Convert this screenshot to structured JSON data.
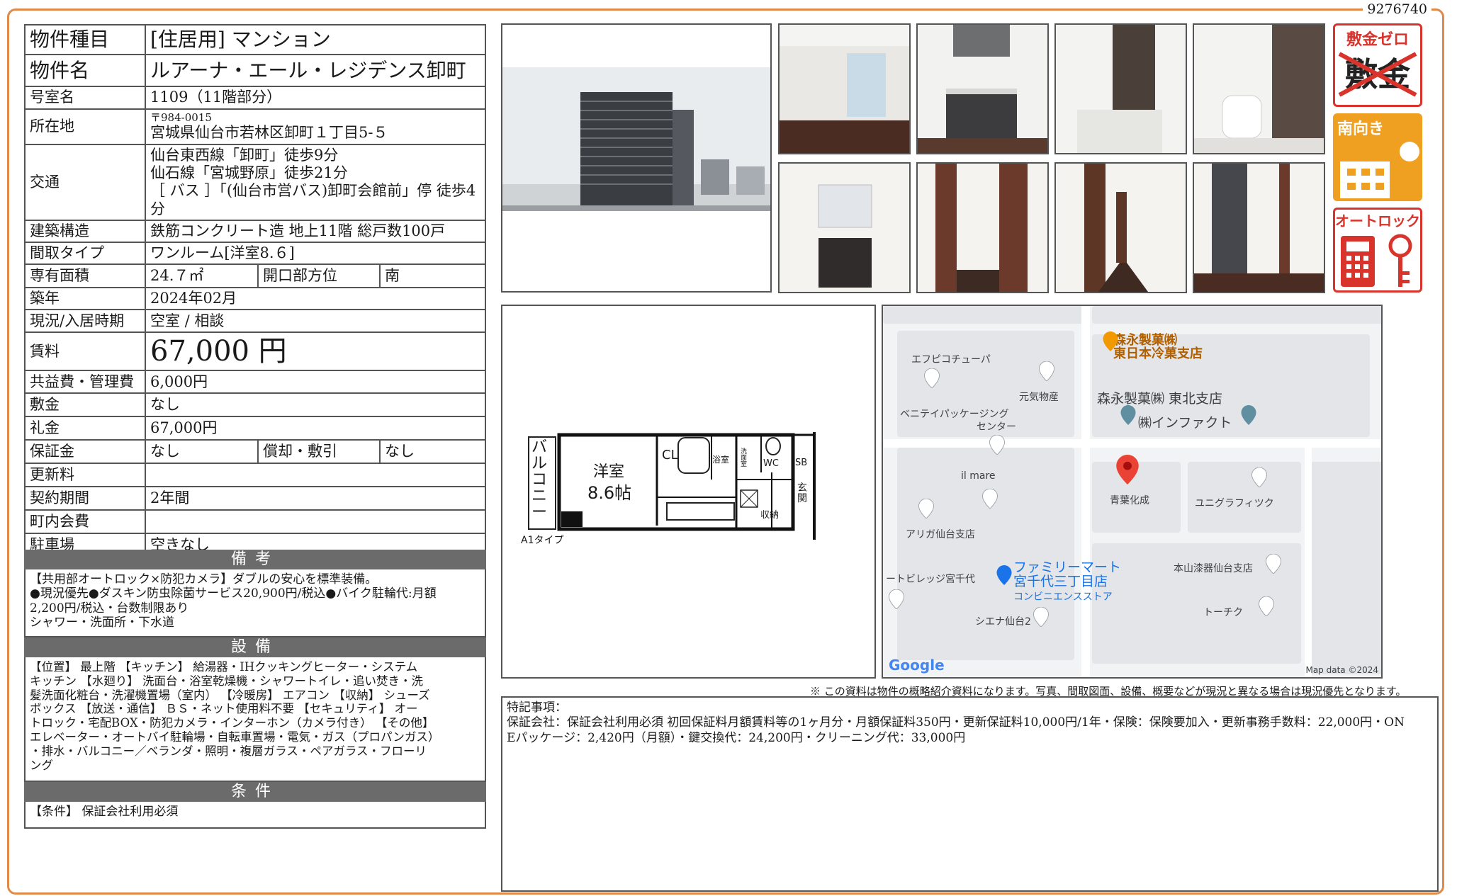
{
  "doc_id": "9276740",
  "spec": {
    "type_label": "物件種目",
    "type_value": "[住居用] マンション",
    "name_label": "物件名",
    "name_value": "ルアーナ・エール・レジデンス卸町",
    "room_label": "号室名",
    "room_value": "1109（11階部分）",
    "address_label": "所在地",
    "postal": "〒984-0015",
    "address_value": "宮城県仙台市若林区卸町１丁目5-５",
    "transit_label": "交通",
    "transit_1": "仙台東西線「卸町」徒歩9分",
    "transit_2": "仙石線「宮城野原」徒歩21分",
    "transit_3": "［ バス ］「(仙台市営バス)卸町会館前」停 徒歩4分",
    "structure_label": "建築構造",
    "structure_value": "鉄筋コンクリート造 地上11階 総戸数100戸",
    "layout_label": "間取タイプ",
    "layout_value": "ワンルーム[洋室8.６]",
    "area_label": "専有面積",
    "area_value": "24.７㎡",
    "direction_label": "開口部方位",
    "direction_value": "南",
    "built_label": "築年",
    "built_value": "2024年02月",
    "status_label": "現況/入居時期",
    "status_value": "空室 / 相談",
    "rent_label": "賃料",
    "rent_value": "67,000 円",
    "fee_label": "共益費・管理費",
    "fee_value": "6,000円",
    "deposit_label": "敷金",
    "deposit_value": "なし",
    "keymoney_label": "礼金",
    "keymoney_value": "67,000円",
    "guarantee_label": "保証金",
    "guarantee_value": "なし",
    "amort_label": "償却・敷引",
    "amort_value": "なし",
    "renewal_label": "更新料",
    "renewal_value": "",
    "contract_label": "契約期間",
    "contract_value": "2年間",
    "council_label": "町内会費",
    "council_value": "",
    "parking_label": "駐車場",
    "parking_value": "空きなし"
  },
  "remarks": {
    "title": "備考",
    "line1": "【共用部オートロック×防犯カメラ】ダブルの安心を標準装備。",
    "line2": "●現況優先●ダスキン防虫除菌サービス20,900円/税込●バイク駐輪代:月額",
    "line3": "2,200円/税込・台数制限あり",
    "line4": "シャワー・洗面所・下水道"
  },
  "equipment": {
    "title": "設備",
    "line1": "【位置】 最上階 【キッチン】 給湯器・IHクッキングヒーター・システム",
    "line2": "キッチン 【水廻り】 洗面台・浴室乾燥機・シャワートイレ・追い焚き・洗",
    "line3": "髪洗面化粧台・洗濯機置場（室内） 【冷暖房】 エアコン 【収納】 シューズ",
    "line4": "ボックス 【放送・通信】 ＢＳ・ネット使用料不要 【セキュリティ】 オー",
    "line5": "トロック・宅配BOX・防犯カメラ・インターホン（カメラ付き） 【その他】",
    "line6": "エレベーター・オートバイ駐輪場・自転車置場・電気・ガス（プロパンガス）",
    "line7": "・排水・バルコニー／ベランダ・照明・複層ガラス・ペアガラス・フローリ",
    "line8": "ング"
  },
  "conditions": {
    "title": "条件",
    "line1": "【条件】 保証会社利用必須"
  },
  "badges": {
    "zero_title": "敷金ゼロ",
    "zero_crossed": "敷金",
    "south_title": "南向き",
    "autolock_title": "オートロック"
  },
  "floorplan": {
    "balcony": "バルコニー",
    "room": "洋室",
    "size": "8.6帖",
    "cl": "CL",
    "bath": "浴室",
    "wash": "洗面室",
    "wc": "WC",
    "sb": "SB",
    "entrance": "玄関",
    "storage": "収納",
    "type": "A1タイプ"
  },
  "map": {
    "l1": "森永製菓㈱",
    "l2": "東日本冷菓支店",
    "l3": "エフピコチューパ",
    "l4": "元気物産",
    "l5": "森永製菓㈱ 東北支店",
    "l6": "ベニテイパッケージング",
    "l7": "センター",
    "l8": "㈱インファクト",
    "l9": "il mare",
    "l10": "青葉化成",
    "l11": "ユニグラフィツク",
    "l12": "アリガ仙台支店",
    "l13": "ファミリーマート",
    "l14": "宮千代三丁目店",
    "l15": "コンビニエンスストア",
    "l16": "ートビレッジ宮千代",
    "l17": "本山漆器仙台支店",
    "l18": "シエナ仙台2",
    "l19": "トーチク",
    "google": "Google",
    "mapdata": "Map data ©2024"
  },
  "note": "※ この資料は物件の概略紹介資料になります。写真、間取図面、設備、概要などが現況と異なる場合は現況優先となります。",
  "special": {
    "title": "特記事項：",
    "line1": "保証会社：保証会社利用必須 初回保証料月額賃料等の1ヶ月分・月額保証料350円・更新保証料10,000円/1年・保険：保険要加入・更新事務手数料：22,000円・ON",
    "line2": "Eパッケージ：2,420円（月額）・鍵交換代：24,200円・クリーニング代：33,000円"
  },
  "colors": {
    "frame": "#e08a4a",
    "badge_red": "#d9342b",
    "badge_orange": "#f0a020",
    "section_gray": "#6b6b6b"
  }
}
